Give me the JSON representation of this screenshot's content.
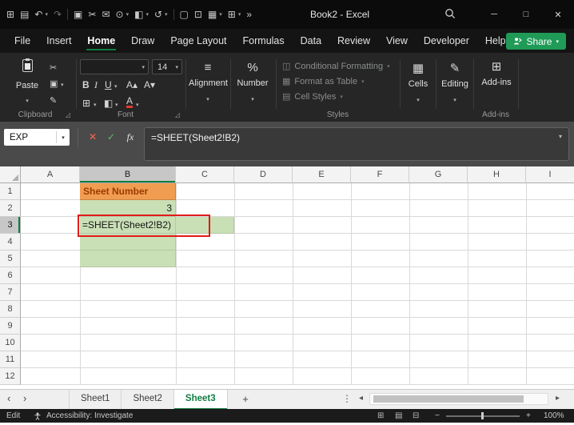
{
  "titlebar": {
    "title": "Book2 - Excel"
  },
  "menu": {
    "tabs": [
      "File",
      "Insert",
      "Home",
      "Draw",
      "Page Layout",
      "Formulas",
      "Data",
      "Review",
      "View",
      "Developer",
      "Help"
    ],
    "active": "Home",
    "share_label": "Share"
  },
  "ribbon": {
    "paste_label": "Paste",
    "font_size": "14",
    "alignment_label": "Alignment",
    "number_label": "Number",
    "styles_items": [
      "Conditional Formatting",
      "Format as Table",
      "Cell Styles"
    ],
    "cells_label": "Cells",
    "editing_label": "Editing",
    "addins_label": "Add-ins",
    "group_labels": {
      "clipboard": "Clipboard",
      "font": "Font",
      "styles": "Styles",
      "addins": "Add-ins"
    }
  },
  "formula_bar": {
    "name_box": "EXP",
    "fx_label": "fx",
    "formula": "=SHEET(Sheet2!B2)"
  },
  "grid": {
    "columns": [
      "A",
      "B",
      "C",
      "D",
      "E",
      "F",
      "G",
      "H",
      "I"
    ],
    "rows": [
      "1",
      "2",
      "3",
      "4",
      "5",
      "6",
      "7",
      "8",
      "9",
      "10",
      "11",
      "12"
    ],
    "cells": {
      "B1": "Sheet Number",
      "B2": "3",
      "B3": "=SHEET(Sheet2!B2)"
    },
    "selected_column": "B",
    "selected_row": "3"
  },
  "sheet_tabs": {
    "tabs": [
      "Sheet1",
      "Sheet2",
      "Sheet3"
    ],
    "active": "Sheet3",
    "add_label": "+"
  },
  "status_bar": {
    "mode": "Edit",
    "accessibility": "Accessibility: Investigate",
    "zoom": "100%"
  },
  "colors": {
    "header_fill": "#f09d52",
    "header_text": "#9c3b00",
    "cell_fill": "#c9dfb6",
    "annotation": "#e11b1b",
    "accent_green": "#107c41",
    "share_green": "#1f9b57"
  }
}
